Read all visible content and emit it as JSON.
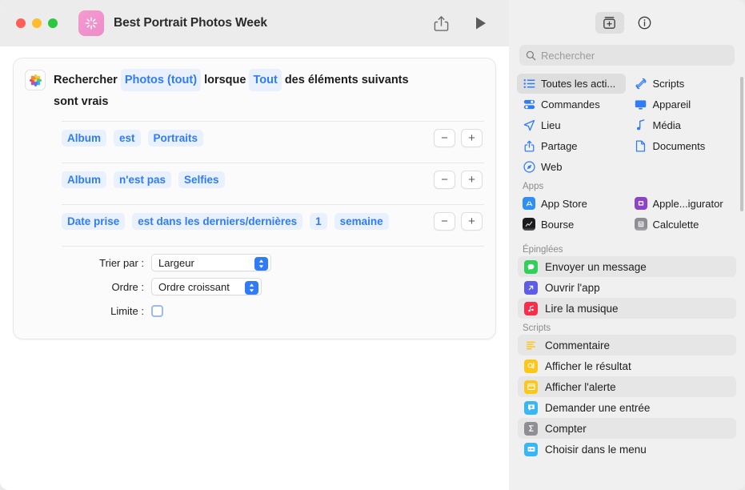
{
  "window": {
    "title": "Best Portrait Photos Week",
    "app_icon": "shortcuts-icon",
    "traffic_lights": [
      "close",
      "minimize",
      "zoom"
    ],
    "toolbar": {
      "share_label": "share-icon",
      "run_label": "play-icon"
    }
  },
  "action_card": {
    "icon": "photos-icon",
    "header": {
      "lead": "Rechercher",
      "source": "Photos (tout)",
      "mid": "lorsque",
      "match": "Tout",
      "tail": "des éléments suivants",
      "tail2": "sont vrais"
    },
    "criteria": [
      {
        "field": "Album",
        "operator": "est",
        "value": "Portraits",
        "extra": null,
        "unit": null
      },
      {
        "field": "Album",
        "operator": "n'est pas",
        "value": "Selfies",
        "extra": null,
        "unit": null
      },
      {
        "field": "Date prise",
        "operator": "est dans les derniers/dernières",
        "value": "1",
        "extra": "semaine",
        "unit": null
      }
    ],
    "row_buttons": {
      "remove": "−",
      "add": "+"
    },
    "sort": {
      "sort_by_label": "Trier par :",
      "sort_by_value": "Largeur",
      "order_label": "Ordre :",
      "order_value": "Ordre croissant",
      "limit_label": "Limite :",
      "limit_checked": false
    }
  },
  "sidebar": {
    "toolbar": {
      "library_icon": "action-library-icon",
      "info_icon": "info-circle-icon"
    },
    "search": {
      "placeholder": "Rechercher",
      "value": "",
      "icon": "search-icon"
    },
    "categories": [
      {
        "label": "Toutes les acti...",
        "icon": "list-bullet-icon",
        "selected": true
      },
      {
        "label": "Scripts",
        "icon": "scripts-icon",
        "selected": false
      },
      {
        "label": "Commandes",
        "icon": "controls-icon",
        "selected": false
      },
      {
        "label": "Appareil",
        "icon": "display-icon",
        "selected": false
      },
      {
        "label": "Lieu",
        "icon": "location-arrow-icon",
        "selected": false
      },
      {
        "label": "Média",
        "icon": "music-note-icon",
        "selected": false
      },
      {
        "label": "Partage",
        "icon": "share-icon",
        "selected": false
      },
      {
        "label": "Documents",
        "icon": "document-icon",
        "selected": false
      },
      {
        "label": "Web",
        "icon": "safari-compass-icon",
        "selected": false
      }
    ],
    "apps_header": "Apps",
    "apps": [
      {
        "label": "App Store",
        "icon": "appstore-icon",
        "color": "#2f8ff7"
      },
      {
        "label": "Apple...igurator",
        "icon": "apple-configurator-icon",
        "color": "#8b44c8"
      },
      {
        "label": "Bourse",
        "icon": "stocks-icon",
        "color": "#1c1c1e"
      },
      {
        "label": "Calculette",
        "icon": "calculator-icon",
        "color": "#8e8e93"
      }
    ],
    "pinned_header": "Épinglées",
    "pinned": [
      {
        "label": "Envoyer un message",
        "icon": "messages-icon",
        "color": "#30d158",
        "alt": true
      },
      {
        "label": "Ouvrir l'app",
        "icon": "open-app-icon",
        "color": "#5e5ce6",
        "alt": false
      },
      {
        "label": "Lire la musique",
        "icon": "music-icon",
        "color": "#fa2d48",
        "alt": true
      }
    ],
    "scripts_header": "Scripts",
    "scripts": [
      {
        "label": "Commentaire",
        "icon": "comment-icon",
        "color": "#ffc517",
        "alt": true
      },
      {
        "label": "Afficher le résultat",
        "icon": "show-result-icon",
        "color": "#ffc517",
        "alt": false
      },
      {
        "label": "Afficher l'alerte",
        "icon": "show-alert-icon",
        "color": "#ffc517",
        "alt": true
      },
      {
        "label": "Demander une entrée",
        "icon": "ask-input-icon",
        "color": "#37b7f5",
        "alt": false
      },
      {
        "label": "Compter",
        "icon": "count-sigma-icon",
        "color": "#8e8e93",
        "alt": true
      },
      {
        "label": "Choisir dans le menu",
        "icon": "choose-menu-icon",
        "color": "#37b7f5",
        "alt": false
      }
    ]
  },
  "colors": {
    "accent_blue": "#2f7cf6",
    "pill_bg": "#eaf1fe",
    "sidebar_bg": "#f1f0f0",
    "titlebar_bg": "#ececec"
  }
}
